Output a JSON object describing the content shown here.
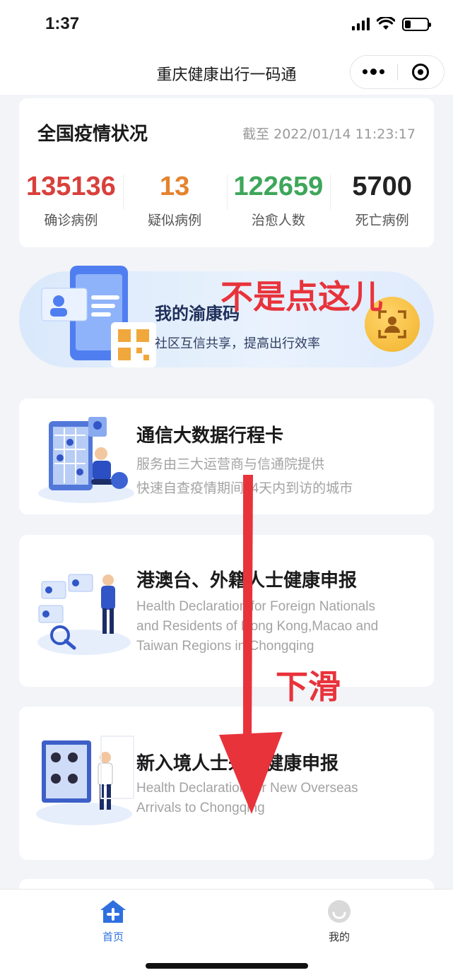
{
  "status_bar": {
    "time": "1:37",
    "battery_level": 0.28
  },
  "nav": {
    "title": "重庆健康出行一码通"
  },
  "stats": {
    "title": "全国疫情状况",
    "updated": "截至 2022/01/14 11:23:17",
    "items": [
      {
        "value": "135136",
        "label": "确诊病例",
        "color": "#d8403c"
      },
      {
        "value": "13",
        "label": "疑似病例",
        "color": "#e4832d"
      },
      {
        "value": "122659",
        "label": "治愈人数",
        "color": "#3ea65a"
      },
      {
        "value": "5700",
        "label": "死亡病例",
        "color": "#222222"
      }
    ]
  },
  "banner": {
    "title": "我的渝康码",
    "subtitle": "社区互信共享，提高出行效率"
  },
  "cards": [
    {
      "title": "通信大数据行程卡",
      "lines": [
        "服务由三大运营商与信通院提供",
        "快速自查疫情期间14天内到访的城市"
      ]
    },
    {
      "title": "港澳台、外籍人士健康申报",
      "lines": [
        "Health Declaration for Foreign Nationals",
        "and Residents of Hong Kong,Macao and",
        "Taiwan Regions in Chongqing"
      ]
    },
    {
      "title": "新入境人士来渝健康申报",
      "lines": [
        "Health Declaration for New Overseas",
        "Arrivals to Chongqing"
      ]
    }
  ],
  "annotations": {
    "not_here": "不是点这儿",
    "scroll_down": "下滑"
  },
  "tabs": [
    {
      "label": "首页",
      "icon": "home-plus-icon",
      "active": true
    },
    {
      "label": "我的",
      "icon": "user-avatar-icon",
      "active": false
    }
  ],
  "colors": {
    "accent": "#2f6fe0",
    "annotation": "#e8333b"
  }
}
